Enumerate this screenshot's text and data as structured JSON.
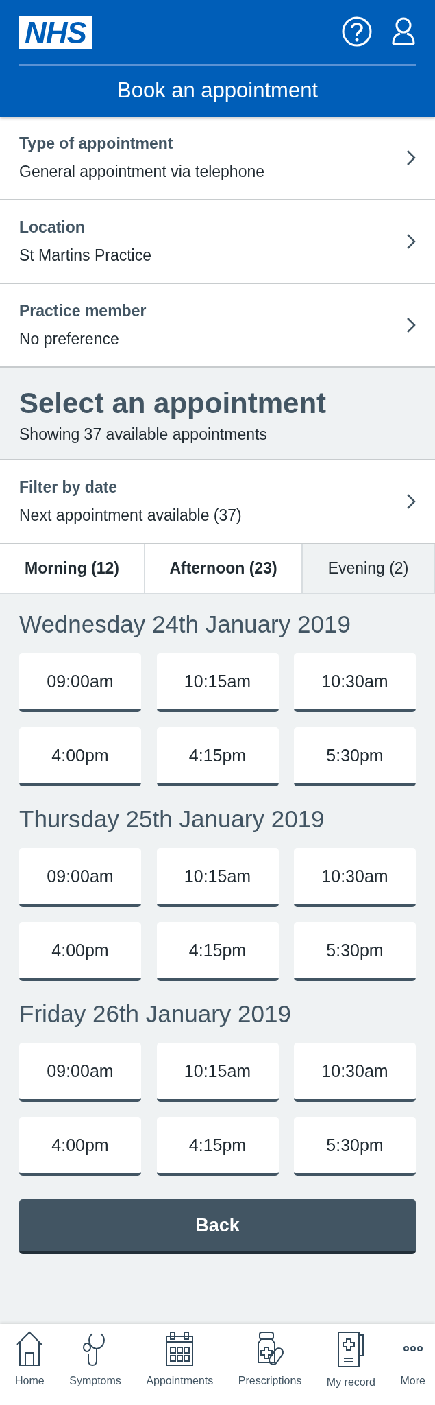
{
  "header": {
    "logo": "NHS",
    "title": "Book an appointment"
  },
  "options": [
    {
      "label": "Type of appointment",
      "value": "General appointment via telephone"
    },
    {
      "label": "Location",
      "value": "St Martins Practice"
    },
    {
      "label": "Practice member",
      "value": "No preference"
    }
  ],
  "select": {
    "heading": "Select an appointment",
    "subheading": "Showing 37 available appointments"
  },
  "filter": {
    "label": "Filter by date",
    "value": "Next appointment available (37)"
  },
  "tabs": [
    {
      "label": "Morning (12)",
      "selected": true
    },
    {
      "label": "Afternoon (23)",
      "selected": true
    },
    {
      "label": "Evening (2)",
      "selected": false
    }
  ],
  "days": [
    {
      "date": "Wednesday 24th January 2019",
      "slots": [
        "09:00am",
        "10:15am",
        "10:30am",
        "4:00pm",
        "4:15pm",
        "5:30pm"
      ]
    },
    {
      "date": "Thursday 25th January 2019",
      "slots": [
        "09:00am",
        "10:15am",
        "10:30am",
        "4:00pm",
        "4:15pm",
        "5:30pm"
      ]
    },
    {
      "date": "Friday 26th January 2019",
      "slots": [
        "09:00am",
        "10:15am",
        "10:30am",
        "4:00pm",
        "4:15pm",
        "5:30pm"
      ]
    }
  ],
  "back_button": "Back",
  "nav": [
    {
      "kind": "home",
      "label": "Home"
    },
    {
      "kind": "symptoms",
      "label": "Symptoms"
    },
    {
      "kind": "appointments",
      "label": "Appointments"
    },
    {
      "kind": "prescriptions",
      "label": "Prescriptions"
    },
    {
      "kind": "record",
      "label": "My record"
    },
    {
      "kind": "more",
      "label": "More"
    }
  ]
}
